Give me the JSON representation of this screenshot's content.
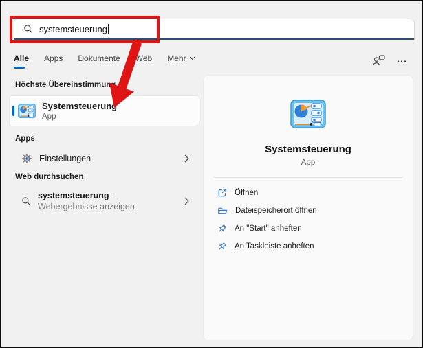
{
  "colors": {
    "accent_blue": "#0067c0",
    "annotation_red": "#df1515",
    "action_icon_blue": "#3a79c8",
    "search_underline": "#2c4c72"
  },
  "search": {
    "value": "systemsteuerung"
  },
  "tabs": [
    {
      "label": "Alle",
      "active": true
    },
    {
      "label": "Apps",
      "active": false
    },
    {
      "label": "Dokumente",
      "active": false
    },
    {
      "label": "Web",
      "active": false
    },
    {
      "label": "Mehr",
      "active": false,
      "chevron": true
    }
  ],
  "left": {
    "sections": {
      "best_match_header": "Höchste Übereinstimmung",
      "apps_header": "Apps",
      "web_header": "Web durchsuchen"
    },
    "best_match": {
      "title": "Systemsteuerung",
      "subtitle": "App"
    },
    "apps_item": {
      "label": "Einstellungen"
    },
    "web_item": {
      "query": "systemsteuerung",
      "suffix": " - Webergebnisse anzeigen"
    }
  },
  "preview": {
    "title": "Systemsteuerung",
    "subtitle": "App",
    "actions": [
      {
        "icon": "open-icon",
        "label": "Öffnen"
      },
      {
        "icon": "folder-open-icon",
        "label": "Dateispeicherort öffnen"
      },
      {
        "icon": "pin-icon",
        "label": "An \"Start\" anheften"
      },
      {
        "icon": "pin-icon",
        "label": "An Taskleiste anheften"
      }
    ]
  }
}
